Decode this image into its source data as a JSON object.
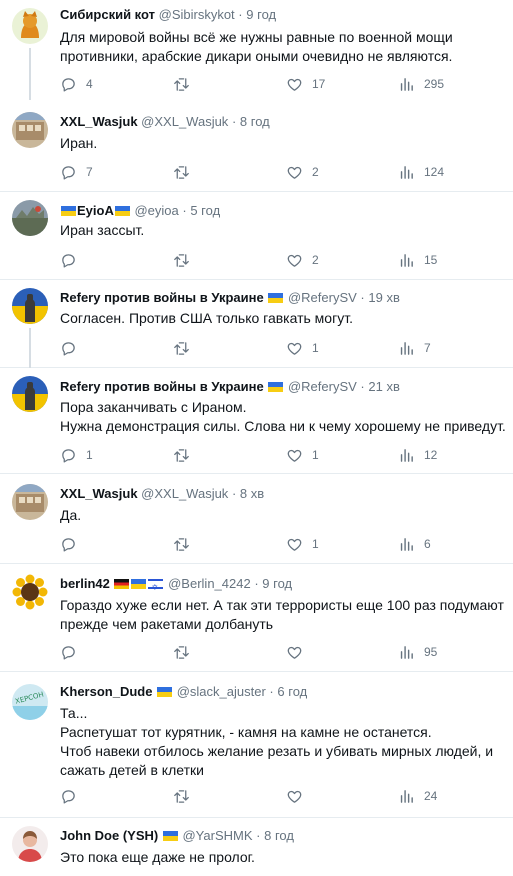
{
  "tweets": [
    {
      "name": "Сибирский кот",
      "handle": "@Sibirskykot",
      "time": "9 год",
      "lines": [
        "Для мировой войны всё же нужны равные по военной мощи",
        "противники, арабские дикари оными очевидно не являются."
      ],
      "replies": "4",
      "retweets": "",
      "likes": "17",
      "views": "295"
    },
    {
      "name": "XXL_Wasjuk",
      "handle": "@XXL_Wasjuk",
      "time": "8 год",
      "lines": [
        "Иран."
      ],
      "replies": "7",
      "retweets": "",
      "likes": "2",
      "views": "124"
    },
    {
      "name": "EyioA",
      "handle": "@eyioa",
      "time": "5 год",
      "lines": [
        "Иран зассыт."
      ],
      "replies": "",
      "retweets": "",
      "likes": "2",
      "views": "15"
    },
    {
      "name": "Refery против войны в Украине",
      "handle": "@ReferySV",
      "time": "19 хв",
      "lines": [
        "Согласен. Против США только гавкать могут."
      ],
      "replies": "",
      "retweets": "",
      "likes": "1",
      "views": "7"
    },
    {
      "name": "Refery против войны в Украине",
      "handle": "@ReferySV",
      "time": "21 хв",
      "lines": [
        "Пора заканчивать с Ираном.",
        "Нужна демонстрация силы. Слова ни к чему хорошему не приведут."
      ],
      "replies": "1",
      "retweets": "",
      "likes": "1",
      "views": "12"
    },
    {
      "name": "XXL_Wasjuk",
      "handle": "@XXL_Wasjuk",
      "time": "8 хв",
      "lines": [
        "Да."
      ],
      "replies": "",
      "retweets": "",
      "likes": "1",
      "views": "6"
    },
    {
      "name": "berlin42",
      "handle": "@Berlin_4242",
      "time": "9 год",
      "lines": [
        "Гораздо хуже если нет. А так эти террористы еще 100 раз подумают",
        "прежде чем ракетами долбануть"
      ],
      "replies": "",
      "retweets": "",
      "likes": "",
      "views": "95"
    },
    {
      "name": "Kherson_Dude",
      "handle": "@slack_ajuster",
      "time": "6 год",
      "lines": [
        "Та...",
        "Распетушат тот курятник, - камня на камне не останется.",
        "Чтоб навеки отбилось желание резать и убивать мирных людей, и",
        "сажать детей в клетки"
      ],
      "replies": "",
      "retweets": "",
      "likes": "",
      "views": "24"
    },
    {
      "name": "John Doe (YSH)",
      "handle": "@YarSHMK",
      "time": "8 год",
      "lines": [
        "Это пока еще даже не пролог."
      ],
      "replies": "",
      "retweets": "",
      "likes": "",
      "views": ""
    }
  ],
  "colors": {
    "text": "#0f1419",
    "secondary": "#66737f",
    "divider": "#e6ecf0",
    "thread": "#d6dde3"
  }
}
